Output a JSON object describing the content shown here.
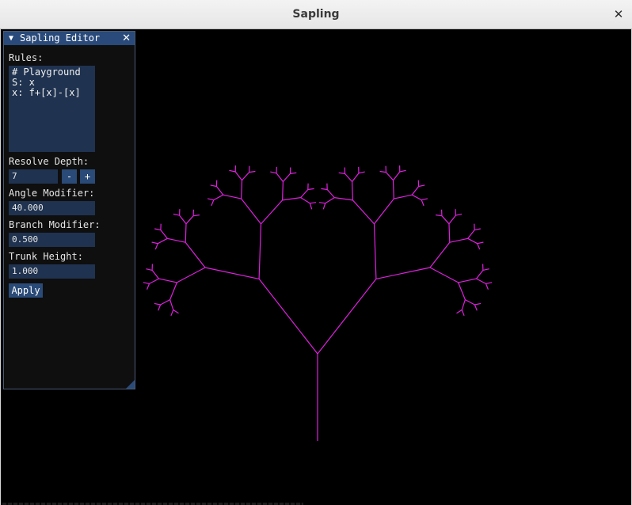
{
  "window": {
    "title": "Sapling",
    "close_glyph": "✕"
  },
  "editor": {
    "title": "Sapling Editor",
    "collapse_glyph": "▼",
    "close_glyph": "✕",
    "rules_label": "Rules:",
    "rules_lines": [
      "# Playground",
      "S: x",
      "x: f+[x]-[x]"
    ],
    "resolve_depth_label": "Resolve Depth:",
    "resolve_depth_value": "7",
    "decrement_label": "-",
    "increment_label": "+",
    "angle_modifier_label": "Angle Modifier:",
    "angle_modifier_value": "40.000",
    "branch_modifier_label": "Branch Modifier:",
    "branch_modifier_value": "0.500",
    "trunk_height_label": "Trunk Height:",
    "trunk_height_value": "1.000",
    "apply_label": "Apply"
  },
  "tree": {
    "color": "#e020e0",
    "axiom": "x",
    "rule": "f+[x]-[x]",
    "depth": 7,
    "angle_deg": 40,
    "branch_ratio": 0.5,
    "trunk_height": 1.0
  },
  "theme": {
    "panel_header": "#294a7a",
    "field_bg": "#1f324f",
    "button_bg": "#2a4a78",
    "canvas_bg": "#000000"
  }
}
